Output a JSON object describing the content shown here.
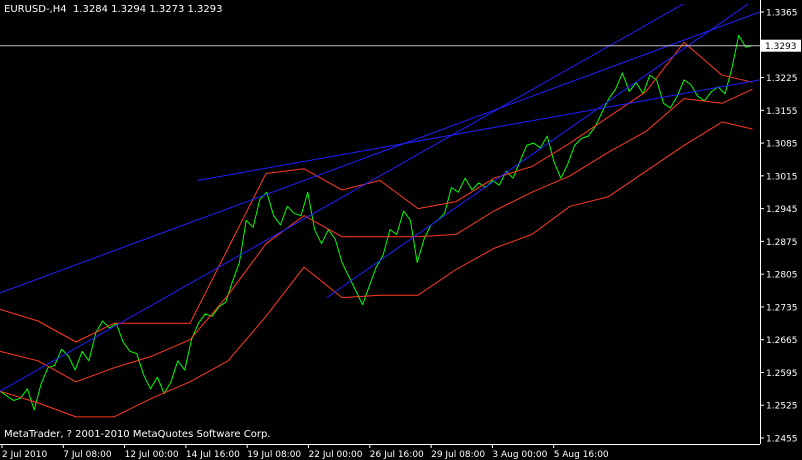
{
  "header": {
    "symbol": "EURUSD-,H4",
    "ohlc": "1.3284 1.3294 1.3273 1.3293"
  },
  "footer": {
    "copyright": "MetaTrader, ? 2001-2010 MetaQuotes Software Corp."
  },
  "colors": {
    "background": "#000000",
    "price_line": "#00ff00",
    "bands": "#ff3b1f",
    "trendlines": "#2020ff",
    "axis": "#ffffff",
    "current_price_line": "#c0c0c0",
    "price_box_bg": "#ffffff",
    "price_box_text": "#000000"
  },
  "chart_data": {
    "type": "line",
    "x_labels": [
      "2 Jul 2010",
      "7 Jul 08:00",
      "12 Jul 00:00",
      "14 Jul 16:00",
      "19 Jul 08:00",
      "22 Jul 00:00",
      "26 Jul 16:00",
      "29 Jul 08:00",
      "3 Aug 00:00",
      "5 Aug 16:00"
    ],
    "y_ticks": [
      "1.3365",
      "1.3295",
      "1.3225",
      "1.3155",
      "1.3085",
      "1.3015",
      "1.2945",
      "1.2875",
      "1.2805",
      "1.2735",
      "1.2665",
      "1.2595",
      "1.2525",
      "1.2455"
    ],
    "current_price": "1.3293",
    "ylim": [
      1.2455,
      1.3365
    ],
    "grid": false,
    "series": [
      {
        "color": "#00ff00",
        "x": [
          0,
          0.9,
          1.8,
          2.7,
          3.6,
          4.5,
          5.4,
          6.3,
          7.2,
          8.1,
          9.0,
          9.9,
          10.8,
          11.7,
          12.6,
          13.5,
          14.4,
          15.3,
          16.2,
          17.1,
          18.0,
          18.9,
          19.8,
          20.7,
          21.6,
          22.5,
          23.4,
          24.3,
          25.2,
          26.1,
          27.0,
          27.9,
          28.8,
          29.7,
          30.6,
          31.5,
          32.4,
          33.3,
          34.2,
          35.1,
          36.0,
          36.9,
          37.8,
          38.7,
          39.6,
          40.5,
          41.4,
          42.3,
          43.2,
          44.1,
          45.0,
          45.9,
          46.8,
          47.7,
          48.6,
          49.5,
          50.4,
          51.3,
          52.2,
          53.1,
          54.0,
          54.9,
          55.8,
          56.7,
          57.6,
          58.5,
          59.4,
          60.3,
          61.2,
          62.1,
          63.0,
          63.9,
          64.8,
          65.7,
          66.6,
          67.5,
          68.4,
          69.3,
          70.2,
          71.1,
          72.0,
          72.9,
          73.8,
          74.7,
          75.6,
          76.5,
          77.4,
          78.3,
          79.2,
          80.1,
          81.0,
          81.9,
          82.8,
          83.7,
          84.6,
          85.5,
          86.4,
          87.3,
          88.2,
          89.1,
          90.0,
          90.9,
          91.8,
          92.7,
          93.6,
          94.5,
          95.4,
          96.3,
          97.2,
          98.1,
          99.0
        ],
        "y": [
          1.2555,
          1.2545,
          1.2535,
          1.254,
          1.256,
          1.2515,
          1.257,
          1.2605,
          1.261,
          1.2645,
          1.263,
          1.26,
          1.264,
          1.262,
          1.268,
          1.2705,
          1.269,
          1.27,
          1.266,
          1.264,
          1.2635,
          1.259,
          1.256,
          1.2585,
          1.255,
          1.2575,
          1.262,
          1.26,
          1.2665,
          1.27,
          1.272,
          1.2715,
          1.2735,
          1.2745,
          1.279,
          1.283,
          1.292,
          1.2905,
          1.2965,
          1.298,
          1.293,
          1.291,
          1.295,
          1.2935,
          1.293,
          1.298,
          1.29,
          1.287,
          1.29,
          1.288,
          1.283,
          1.28,
          1.277,
          1.274,
          1.278,
          1.282,
          1.2845,
          1.29,
          1.289,
          1.294,
          1.292,
          1.283,
          1.288,
          1.291,
          1.292,
          1.2935,
          1.299,
          1.298,
          1.301,
          1.2985,
          1.3,
          1.299,
          1.3005,
          1.2995,
          1.3025,
          1.301,
          1.3045,
          1.308,
          1.3085,
          1.3075,
          1.31,
          1.3045,
          1.301,
          1.304,
          1.308,
          1.3095,
          1.31,
          1.312,
          1.315,
          1.318,
          1.32,
          1.3235,
          1.3195,
          1.3215,
          1.319,
          1.323,
          1.322,
          1.317,
          1.316,
          1.3185,
          1.322,
          1.321,
          1.3185,
          1.3175,
          1.3195,
          1.3205,
          1.319,
          1.3245,
          1.3315,
          1.329,
          1.3293
        ]
      },
      {
        "color": "#ff3b1f",
        "x": [
          0,
          5,
          10,
          15,
          20,
          25,
          30,
          35,
          40,
          45,
          50,
          55,
          60,
          65,
          70,
          75,
          80,
          85,
          90,
          95,
          99
        ],
        "y": [
          1.273,
          1.2705,
          1.266,
          1.27,
          1.27,
          1.27,
          1.286,
          1.302,
          1.303,
          1.2985,
          1.3005,
          1.2945,
          1.296,
          1.301,
          1.3035,
          1.3085,
          1.314,
          1.3195,
          1.33,
          1.323,
          1.3215
        ]
      },
      {
        "color": "#ff3b1f",
        "x": [
          0,
          5,
          10,
          15,
          20,
          25,
          30,
          35,
          40,
          45,
          50,
          55,
          60,
          65,
          70,
          75,
          80,
          85,
          90,
          95,
          99
        ],
        "y": [
          1.264,
          1.262,
          1.2575,
          1.2605,
          1.263,
          1.2665,
          1.276,
          1.287,
          1.293,
          1.2885,
          1.2885,
          1.2885,
          1.289,
          1.294,
          1.298,
          1.3015,
          1.3065,
          1.311,
          1.318,
          1.317,
          1.32
        ]
      },
      {
        "color": "#ff3b1f",
        "x": [
          0,
          5,
          10,
          15,
          20,
          25,
          30,
          35,
          40,
          45,
          50,
          55,
          60,
          65,
          70,
          75,
          80,
          85,
          90,
          95,
          99
        ],
        "y": [
          1.2555,
          1.253,
          1.25,
          1.25,
          1.254,
          1.2575,
          1.262,
          1.2715,
          1.282,
          1.2755,
          1.276,
          1.276,
          1.2815,
          1.286,
          1.289,
          1.295,
          1.297,
          1.3025,
          1.308,
          1.313,
          1.3115
        ]
      },
      {
        "color": "#2020ff",
        "x": [
          0,
          100
        ],
        "y": [
          1.2765,
          1.3365
        ]
      },
      {
        "color": "#2020ff",
        "x": [
          0,
          100
        ],
        "y": [
          1.2555,
          1.3475
        ]
      },
      {
        "color": "#2020ff",
        "x": [
          26,
          100
        ],
        "y": [
          1.3005,
          1.322
        ]
      },
      {
        "color": "#2020ff",
        "x": [
          43,
          100
        ],
        "y": [
          1.2755,
          1.34
        ]
      }
    ]
  }
}
